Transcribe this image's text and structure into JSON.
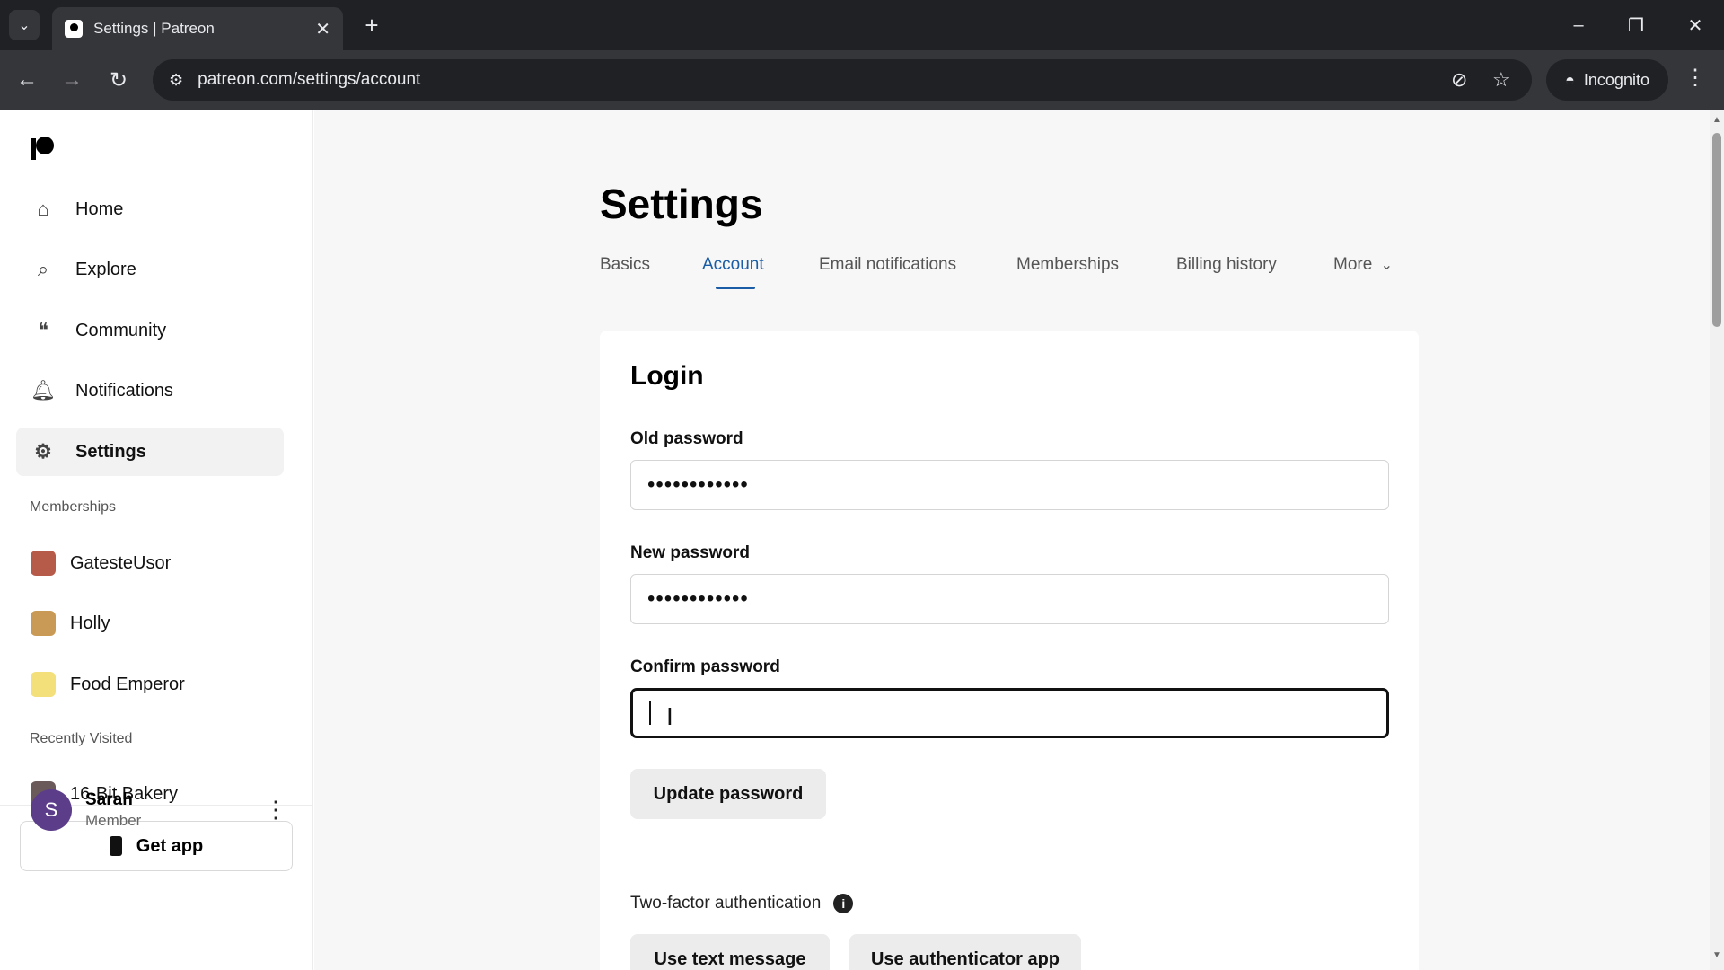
{
  "browser": {
    "tab_title": "Settings | Patreon",
    "url": "patreon.com/settings/account",
    "incognito_label": "Incognito"
  },
  "sidebar": {
    "nav": [
      {
        "label": "Home",
        "icon": "home-icon"
      },
      {
        "label": "Explore",
        "icon": "search-icon"
      },
      {
        "label": "Community",
        "icon": "chat-icon"
      },
      {
        "label": "Notifications",
        "icon": "bell-icon"
      },
      {
        "label": "Settings",
        "icon": "gear-icon"
      }
    ],
    "memberships_heading": "Memberships",
    "memberships": [
      {
        "label": "GatesteUsor"
      },
      {
        "label": "Holly"
      },
      {
        "label": "Food Emperor"
      }
    ],
    "recently_visited_heading": "Recently Visited",
    "recently_visited": [
      {
        "label": "16-Bit Bakery"
      }
    ],
    "get_app_label": "Get app",
    "user": {
      "initial": "S",
      "name": "Sarah",
      "role": "Member"
    }
  },
  "main": {
    "title": "Settings",
    "tabs": [
      {
        "label": "Basics"
      },
      {
        "label": "Account"
      },
      {
        "label": "Email notifications"
      },
      {
        "label": "Memberships"
      },
      {
        "label": "Billing history"
      },
      {
        "label": "More"
      }
    ],
    "active_tab": "Account",
    "login": {
      "title": "Login",
      "old_password_label": "Old password",
      "old_password_value": "••••••••••••",
      "new_password_label": "New password",
      "new_password_value": "••••••••••••",
      "confirm_password_label": "Confirm password",
      "confirm_password_value": "",
      "update_button": "Update password",
      "two_factor_label": "Two-factor authentication",
      "text_message_button": "Use text message",
      "authenticator_button": "Use authenticator app"
    }
  }
}
